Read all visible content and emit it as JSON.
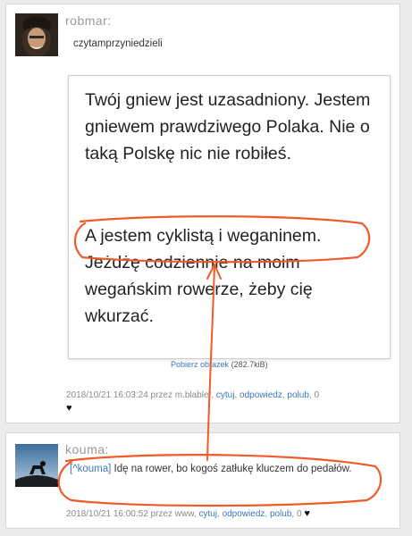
{
  "post1": {
    "username": "robmar:",
    "text": "czytamprzyniedzieli",
    "embed": {
      "para1": "Twój gniew jest uzasadniony. Jestem gniewem prawdziwego Polaka. Nie o taką Polskę nic nie robiłeś.",
      "para2": "A jestem cyklistą i weganinem. Jeżdżę codziennie na moim wegańskim rowerze, żeby cię wkurzać."
    },
    "download_label": "Pobierz obrazek",
    "download_size": "(282.7kiB)",
    "meta_prefix": "2018/10/21 16:03:24 przez m.blabler,",
    "cite": "cytuj",
    "reply": "odpowiedz",
    "like": "polub",
    "likes": "0",
    "heart": "♥"
  },
  "post2": {
    "username": "kouma:",
    "quote": "[^kouma]",
    "text": "Idę na rower, bo kogoś zatłukę kluczem do pedałów.",
    "meta_prefix": "2018/10/21 16:00:52 przez www,",
    "cite": "cytuj",
    "reply": "odpowiedz",
    "like": "polub",
    "likes": "0",
    "heart": "♥"
  },
  "colors": {
    "annotation": "#f05a28",
    "link": "#3a78b8"
  }
}
